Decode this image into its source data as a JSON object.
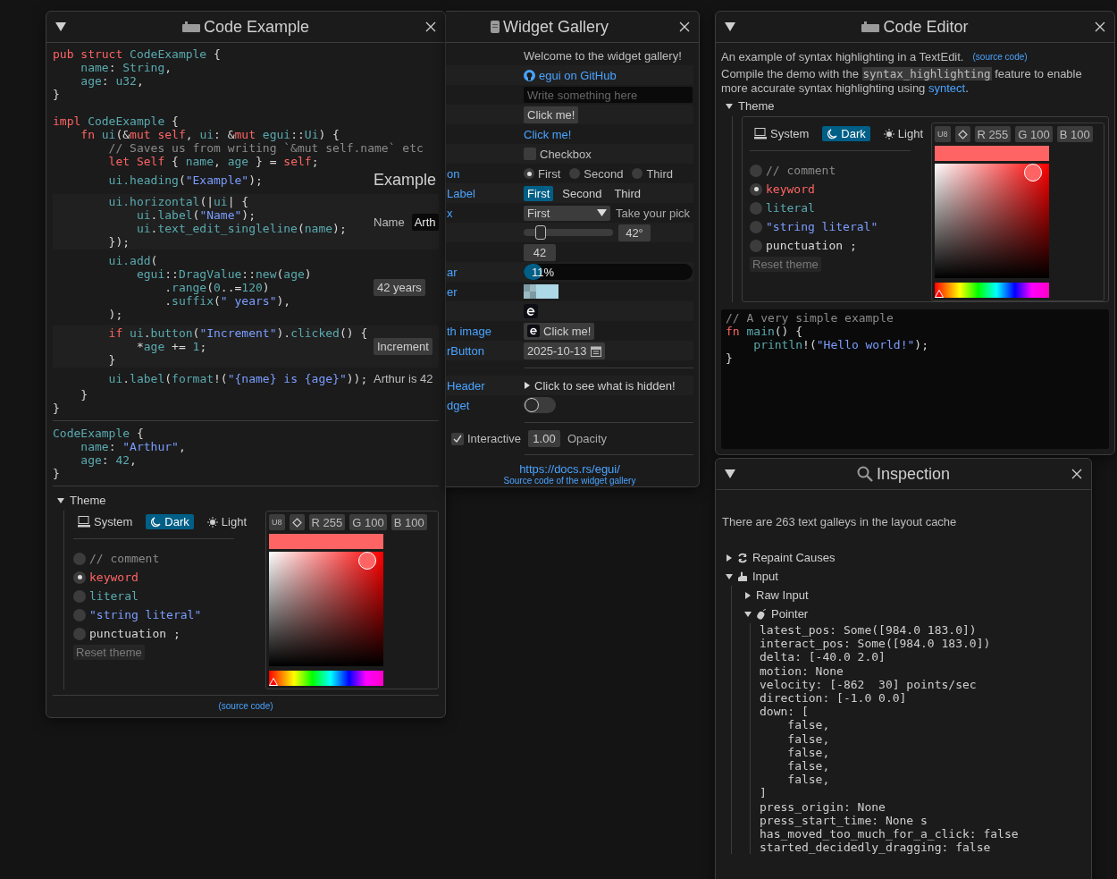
{
  "code_example": {
    "title": "Code Example",
    "struct_code": [
      [
        {
          "kind": "kw",
          "text": "pub struct "
        },
        {
          "kind": "lit",
          "text": "CodeExample"
        },
        {
          "kind": "p",
          "text": " {"
        }
      ],
      [
        {
          "kind": "lit",
          "text": "    name"
        },
        {
          "kind": "p",
          "text": ": "
        },
        {
          "kind": "lit",
          "text": "String"
        },
        {
          "kind": "p",
          "text": ","
        }
      ],
      [
        {
          "kind": "lit",
          "text": "    age"
        },
        {
          "kind": "p",
          "text": ": "
        },
        {
          "kind": "lit",
          "text": "u32"
        },
        {
          "kind": "p",
          "text": ","
        }
      ],
      [
        {
          "kind": "p",
          "text": "}"
        }
      ]
    ],
    "impl_code": [
      [
        {
          "kind": "kw",
          "text": "impl "
        },
        {
          "kind": "lit",
          "text": "CodeExample"
        },
        {
          "kind": "p",
          "text": " {"
        }
      ],
      [
        {
          "kind": "kw",
          "text": "    fn "
        },
        {
          "kind": "lit",
          "text": "ui"
        },
        {
          "kind": "p",
          "text": "(&"
        },
        {
          "kind": "kw",
          "text": "mut self"
        },
        {
          "kind": "p",
          "text": ", "
        },
        {
          "kind": "lit",
          "text": "ui"
        },
        {
          "kind": "p",
          "text": ": &"
        },
        {
          "kind": "kw",
          "text": "mut "
        },
        {
          "kind": "lit",
          "text": "egui"
        },
        {
          "kind": "p",
          "text": "::"
        },
        {
          "kind": "lit",
          "text": "Ui"
        },
        {
          "kind": "p",
          "text": ") {"
        }
      ],
      [
        {
          "kind": "com",
          "text": "        // Saves us from writing `&mut self.name` etc"
        }
      ],
      [
        {
          "kind": "kw",
          "text": "        let Self "
        },
        {
          "kind": "p",
          "text": "{ "
        },
        {
          "kind": "lit",
          "text": "name"
        },
        {
          "kind": "p",
          "text": ", "
        },
        {
          "kind": "lit",
          "text": "age"
        },
        {
          "kind": "p",
          "text": " } = "
        },
        {
          "kind": "kw",
          "text": "self"
        },
        {
          "kind": "p",
          "text": ";"
        }
      ]
    ],
    "rows": [
      {
        "lines": [
          [
            {
              "kind": "lit",
              "text": "        ui.heading"
            },
            {
              "kind": "p",
              "text": "("
            },
            {
              "kind": "str",
              "text": "\"Example\""
            },
            {
              "kind": "p",
              "text": ");"
            }
          ]
        ],
        "widget": {
          "kind": "heading",
          "text": "Example"
        }
      },
      {
        "lines": [
          [
            {
              "kind": "lit",
              "text": "        ui.horizontal"
            },
            {
              "kind": "p",
              "text": "(|"
            },
            {
              "kind": "lit",
              "text": "ui"
            },
            {
              "kind": "p",
              "text": "| {"
            }
          ],
          [
            {
              "kind": "lit",
              "text": "            ui"
            },
            {
              "kind": "p",
              "text": "."
            },
            {
              "kind": "lit",
              "text": "label"
            },
            {
              "kind": "p",
              "text": "("
            },
            {
              "kind": "str",
              "text": "\"Name\""
            },
            {
              "kind": "p",
              "text": ");"
            }
          ],
          [
            {
              "kind": "lit",
              "text": "            ui"
            },
            {
              "kind": "p",
              "text": "."
            },
            {
              "kind": "lit",
              "text": "text_edit_singleline"
            },
            {
              "kind": "p",
              "text": "("
            },
            {
              "kind": "lit",
              "text": "name"
            },
            {
              "kind": "p",
              "text": ");"
            }
          ],
          [
            {
              "kind": "p",
              "text": "        });"
            }
          ]
        ],
        "widget": {
          "kind": "namefield",
          "label": "Name",
          "value": "Arth"
        }
      },
      {
        "lines": [
          [
            {
              "kind": "lit",
              "text": "        ui.add"
            },
            {
              "kind": "p",
              "text": "("
            }
          ],
          [
            {
              "kind": "lit",
              "text": "            egui"
            },
            {
              "kind": "p",
              "text": "::"
            },
            {
              "kind": "lit",
              "text": "DragValue"
            },
            {
              "kind": "p",
              "text": "::"
            },
            {
              "kind": "lit",
              "text": "new"
            },
            {
              "kind": "p",
              "text": "("
            },
            {
              "kind": "lit",
              "text": "age"
            },
            {
              "kind": "p",
              "text": ")"
            }
          ],
          [
            {
              "kind": "p",
              "text": "                ."
            },
            {
              "kind": "lit",
              "text": "range"
            },
            {
              "kind": "p",
              "text": "("
            },
            {
              "kind": "lit",
              "text": "0"
            },
            {
              "kind": "p",
              "text": "..="
            },
            {
              "kind": "lit",
              "text": "120"
            },
            {
              "kind": "p",
              "text": ")"
            }
          ],
          [
            {
              "kind": "p",
              "text": "                ."
            },
            {
              "kind": "lit",
              "text": "suffix"
            },
            {
              "kind": "p",
              "text": "("
            },
            {
              "kind": "str",
              "text": "\" years\""
            },
            {
              "kind": "p",
              "text": "),"
            }
          ],
          [
            {
              "kind": "p",
              "text": "        );"
            }
          ]
        ],
        "widget": {
          "kind": "drag",
          "value": "42 years"
        }
      },
      {
        "lines": [
          [
            {
              "kind": "kw",
              "text": "        if "
            },
            {
              "kind": "lit",
              "text": "ui"
            },
            {
              "kind": "p",
              "text": "."
            },
            {
              "kind": "lit",
              "text": "button"
            },
            {
              "kind": "p",
              "text": "("
            },
            {
              "kind": "str",
              "text": "\"Increment\""
            },
            {
              "kind": "p",
              "text": ")."
            },
            {
              "kind": "lit",
              "text": "clicked"
            },
            {
              "kind": "p",
              "text": "() {"
            }
          ],
          [
            {
              "kind": "p",
              "text": "            *"
            },
            {
              "kind": "lit",
              "text": "age"
            },
            {
              "kind": "p",
              "text": " += "
            },
            {
              "kind": "lit",
              "text": "1"
            },
            {
              "kind": "p",
              "text": ";"
            }
          ],
          [
            {
              "kind": "p",
              "text": "        }"
            }
          ]
        ],
        "widget": {
          "kind": "button",
          "text": "Increment"
        }
      },
      {
        "lines": [
          [
            {
              "kind": "lit",
              "text": "        ui"
            },
            {
              "kind": "p",
              "text": "."
            },
            {
              "kind": "lit",
              "text": "label"
            },
            {
              "kind": "p",
              "text": "("
            },
            {
              "kind": "lit",
              "text": "format"
            },
            {
              "kind": "p",
              "text": "!("
            },
            {
              "kind": "str",
              "text": "\"{name} is {age}\""
            },
            {
              "kind": "p",
              "text": "));"
            }
          ]
        ],
        "widget": {
          "kind": "label",
          "text": "Arthur is 42"
        }
      }
    ],
    "code_end": [
      [
        {
          "kind": "p",
          "text": "    }"
        }
      ],
      [
        {
          "kind": "p",
          "text": "}"
        }
      ]
    ],
    "result": [
      [
        {
          "kind": "lit",
          "text": "CodeExample"
        },
        {
          "kind": "p",
          "text": " {"
        }
      ],
      [
        {
          "kind": "lit",
          "text": "    name"
        },
        {
          "kind": "p",
          "text": ": "
        },
        {
          "kind": "str",
          "text": "\"Arthur\""
        },
        {
          "kind": "p",
          "text": ","
        }
      ],
      [
        {
          "kind": "lit",
          "text": "    age"
        },
        {
          "kind": "p",
          "text": ": "
        },
        {
          "kind": "lit",
          "text": "42"
        },
        {
          "kind": "p",
          "text": ","
        }
      ],
      [
        {
          "kind": "p",
          "text": "}"
        }
      ]
    ],
    "theme": {
      "label": "Theme",
      "expanded": true,
      "modes": [
        {
          "label": "System",
          "selected": false
        },
        {
          "label": "Dark",
          "selected": true
        },
        {
          "label": "Light",
          "selected": false
        }
      ],
      "styles": [
        {
          "kind": "com",
          "text": "// comment",
          "selected": false
        },
        {
          "kind": "kw",
          "text": "keyword",
          "selected": true
        },
        {
          "kind": "lit",
          "text": "literal",
          "selected": false
        },
        {
          "kind": "str",
          "text": "\"string literal\"",
          "selected": false
        },
        {
          "kind": "p",
          "text": "punctuation ;",
          "selected": false
        }
      ],
      "reset": "Reset theme",
      "picker": {
        "format": "U8",
        "channels": [
          "R 255",
          "G 100",
          "B 100"
        ],
        "color": "#ff6464",
        "level": 0
      }
    },
    "source_link": "(source code)"
  },
  "widget_gallery": {
    "title": "Widget Gallery",
    "rows": [
      {
        "kind": "text",
        "text": "Welcome to the widget gallery!"
      },
      {
        "kind": "iconlink",
        "text": "egui on GitHub"
      },
      {
        "kind": "field",
        "placeholder": "Write something here"
      },
      {
        "kind": "button",
        "text": "Click me!"
      },
      {
        "kind": "link",
        "text": "Click me!"
      },
      {
        "kind": "checkbox",
        "text": "Checkbox",
        "checked": false
      },
      {
        "kind": "radio",
        "label": "on",
        "options": [
          {
            "text": "First",
            "selected": true
          },
          {
            "text": "Second",
            "selected": false
          },
          {
            "text": "Third",
            "selected": false
          }
        ]
      },
      {
        "kind": "selectable",
        "label": "Label",
        "options": [
          {
            "text": "First",
            "selected": true
          },
          {
            "text": "Second",
            "selected": false
          },
          {
            "text": "Third",
            "selected": false
          }
        ]
      },
      {
        "kind": "combo",
        "label": "x",
        "value": "First",
        "hint": "Take your pick"
      },
      {
        "kind": "slider",
        "level": 0.15,
        "value": "42°"
      },
      {
        "kind": "drag",
        "value": "42"
      },
      {
        "kind": "progress",
        "label": "ar",
        "level": 0.11,
        "text": "11%"
      },
      {
        "kind": "color",
        "label": "er"
      },
      {
        "kind": "image"
      },
      {
        "kind": "imagebutton",
        "label": "th image",
        "text": "Click me!"
      },
      {
        "kind": "date",
        "label": "rButton",
        "value": "2025-10-13"
      },
      {
        "kind": "separator"
      },
      {
        "kind": "collapsing",
        "label": "Header",
        "text": "Click to see what is hidden!",
        "expanded": false
      },
      {
        "kind": "toggle",
        "label": "dget",
        "on": false
      }
    ],
    "interactive": {
      "text": "Interactive",
      "checked": true
    },
    "opacity": {
      "value": "1.00",
      "label": "Opacity"
    },
    "docs_link": "https://docs.rs/egui/",
    "source_link": "Source code of the widget gallery"
  },
  "code_editor": {
    "title": "Code Editor",
    "intro": "An example of syntax highlighting in a TextEdit.",
    "source_link": "(source code)",
    "note": {
      "before": "Compile the demo with the",
      "code": "syntax_highlighting",
      "after": "feature to enable more accurate syntax highlighting using",
      "link": "syntect",
      "end": "."
    },
    "theme": {
      "label": "Theme",
      "expanded": true,
      "modes": [
        {
          "label": "System",
          "selected": false
        },
        {
          "label": "Dark",
          "selected": true
        },
        {
          "label": "Light",
          "selected": false
        }
      ],
      "styles": [
        {
          "kind": "com",
          "text": "// comment",
          "selected": false
        },
        {
          "kind": "kw",
          "text": "keyword",
          "selected": true
        },
        {
          "kind": "lit",
          "text": "literal",
          "selected": false
        },
        {
          "kind": "str",
          "text": "\"string literal\"",
          "selected": false
        },
        {
          "kind": "p",
          "text": "punctuation ;",
          "selected": false
        }
      ],
      "reset": "Reset theme",
      "picker": {
        "format": "U8",
        "channels": [
          "R 255",
          "G 100",
          "B 100"
        ],
        "color": "#ff6464",
        "level": 0
      }
    },
    "code": [
      [
        {
          "kind": "com",
          "text": "// A very simple example"
        }
      ],
      [
        {
          "kind": "kw",
          "text": "fn "
        },
        {
          "kind": "lit",
          "text": "main"
        },
        {
          "kind": "p",
          "text": "() {"
        }
      ],
      [
        {
          "kind": "lit",
          "text": "    println"
        },
        {
          "kind": "p",
          "text": "!("
        },
        {
          "kind": "str",
          "text": "\"Hello world!\""
        },
        {
          "kind": "p",
          "text": ");"
        }
      ],
      [
        {
          "kind": "p",
          "text": "}"
        }
      ]
    ]
  },
  "inspection": {
    "title": "Inspection",
    "cache_note": "There are 263 text galleys in the layout cache",
    "tree": [
      {
        "label": "Repaint Causes",
        "expanded": false
      },
      {
        "label": "Input",
        "expanded": true,
        "children": [
          {
            "label": "Raw Input",
            "expanded": false
          },
          {
            "label": "Pointer",
            "expanded": true,
            "lines": [
              "latest_pos: Some([984.0 183.0])",
              "interact_pos: Some([984.0 183.0])",
              "delta: [-40.0 2.0]",
              "motion: None",
              "velocity: [-862  30] points/sec",
              "direction: [-1.0 0.0]",
              "down: [",
              "    false,",
              "    false,",
              "    false,",
              "    false,",
              "    false,",
              "]",
              "press_origin: None",
              "press_start_time: None s",
              "has_moved_too_much_for_a_click: false",
              "started_decidedly_dragging: false"
            ]
          }
        ]
      }
    ]
  }
}
